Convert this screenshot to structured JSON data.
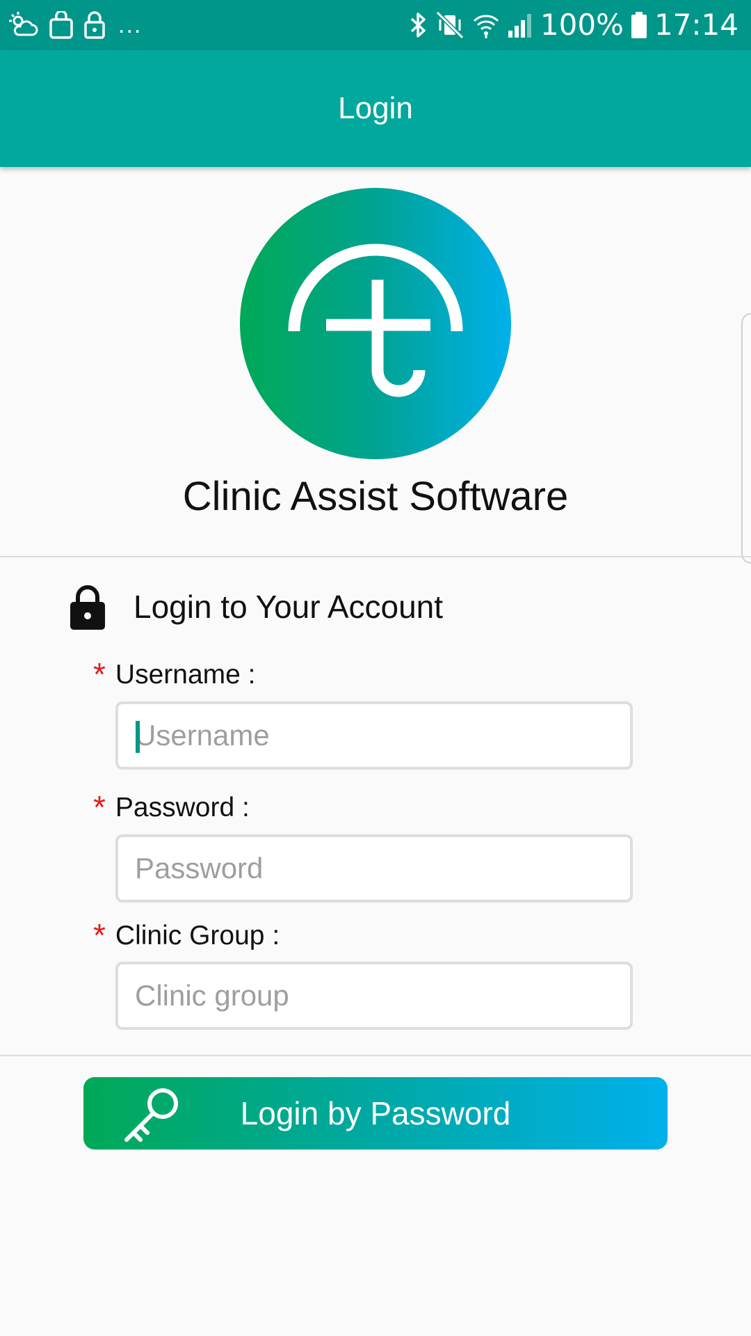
{
  "status_bar": {
    "battery": "100%",
    "time": "17:14",
    "more_indicator": "...",
    "icons_left": [
      "weather-icon",
      "shopping-bag-icon",
      "lock-icon"
    ],
    "icons_right": [
      "bluetooth-icon",
      "vibrate-mute-icon",
      "wifi-icon",
      "signal-icon",
      "battery-icon"
    ]
  },
  "app_bar": {
    "title": "Login"
  },
  "brand": {
    "name": "Clinic Assist Software",
    "gradient_start": "#00a956",
    "gradient_end": "#00b0ea"
  },
  "login_section": {
    "title": "Login to Your Account",
    "fields": [
      {
        "required_mark": "*",
        "label": "Username :",
        "value": "",
        "placeholder": "Username"
      },
      {
        "required_mark": "*",
        "label": "Password :",
        "value": "",
        "placeholder": "Password"
      },
      {
        "required_mark": "*",
        "label": "Clinic Group :",
        "value": "",
        "placeholder": "Clinic group"
      }
    ]
  },
  "login_button": {
    "label": "Login by Password"
  },
  "colors": {
    "status_bar": "#00968a",
    "app_bar": "#00a89d",
    "required": "#e31b1b",
    "background": "#fafafa"
  }
}
